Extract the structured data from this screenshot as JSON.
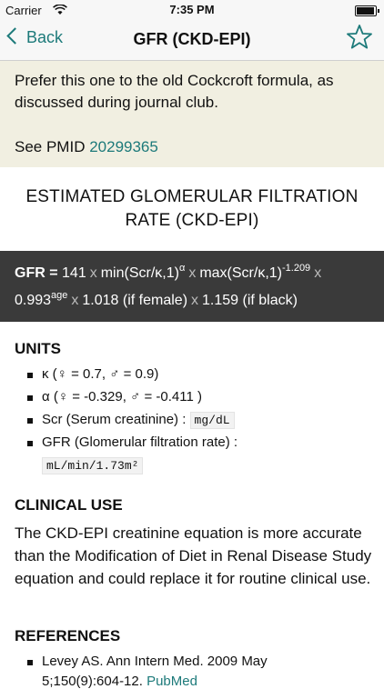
{
  "status": {
    "carrier": "Carrier",
    "time": "7:35 PM"
  },
  "nav": {
    "back_label": "Back",
    "title": "GFR (CKD-EPI)"
  },
  "note": {
    "text": "Prefer this one to the old Cockcroft formula, as discussed during journal club.",
    "see_prefix": "See PMID ",
    "pmid": "20299365"
  },
  "heading": {
    "line1": "ESTIMATED GLOMERULAR FILTRATION",
    "line2": "RATE (CKD-EPI)"
  },
  "formula": {
    "gfr_label": "GFR = ",
    "const1": "141",
    "term1": "min(Scr/κ,1)",
    "term1_exp": "α",
    "term2": "max(Scr/κ,1)",
    "term2_exp": "-1.209",
    "const2": "0.993",
    "const2_exp": "age",
    "female": "1.018 (if female)",
    "black": "1.159 (if black)",
    "times": "x"
  },
  "units": {
    "title": "UNITS",
    "items": [
      {
        "text": "κ (♀ = 0.7, ♂ = 0.9)"
      },
      {
        "text": "α (♀ = -0.329, ♂ = -0.411 )"
      },
      {
        "text": "Scr (Serum creatinine) : ",
        "code": "mg/dL"
      },
      {
        "text": "GFR (Glomerular filtration rate) :"
      },
      {
        "code": "mL/min/1.73m²"
      }
    ]
  },
  "clinical": {
    "title": "CLINICAL USE",
    "text": "The CKD-EPI creatinine equation is more accurate than the Modification of Diet in Renal Disease Study equation and could replace it for routine clinical use."
  },
  "references": {
    "title": "REFERENCES",
    "item1_line1": "Levey AS. Ann Intern Med. 2009 May",
    "item1_line2": "5;150(9):604-12. ",
    "link": "PubMed"
  }
}
